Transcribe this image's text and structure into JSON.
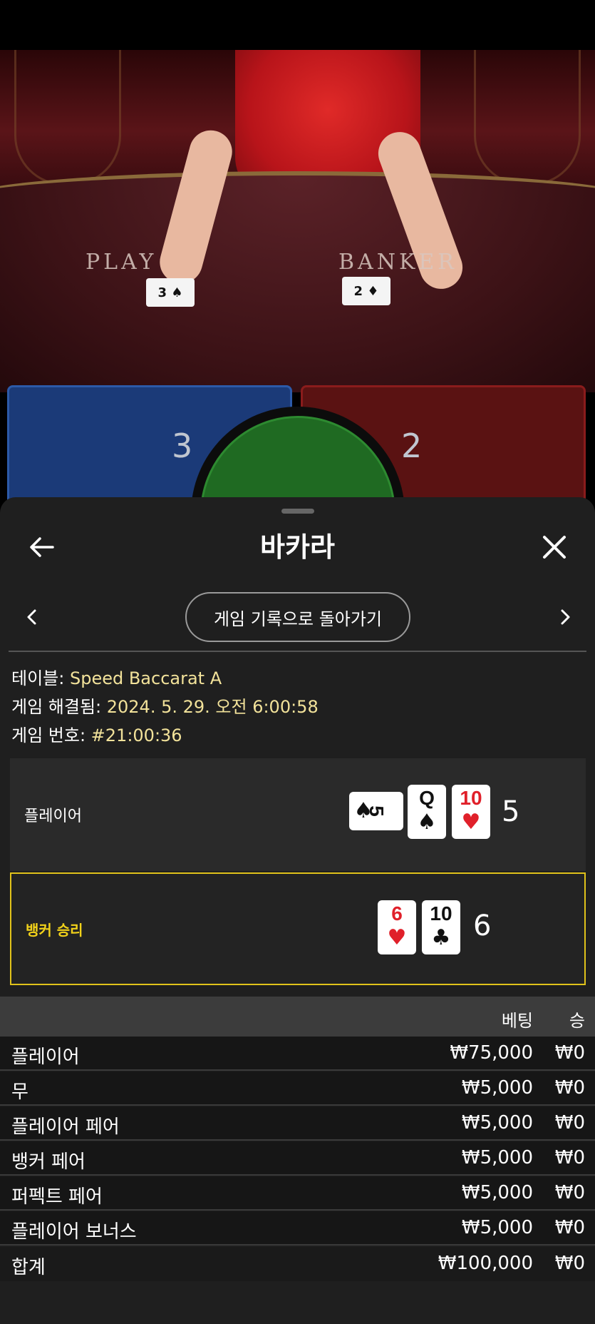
{
  "video": {
    "player_label": "PLAY",
    "banker_label": "BANKER",
    "player_card": "3 ♠",
    "banker_card": "2 ♦"
  },
  "scoreboard": {
    "player_score": "3",
    "banker_score": "2"
  },
  "panel": {
    "title": "바카라",
    "back_to_history": "게임 기록으로 돌아가기",
    "info": {
      "table_label": "테이블: ",
      "table_value": "Speed Baccarat A",
      "resolved_label": "게임 해결됨: ",
      "resolved_value": "2024. 5. 29. 오전 6:00:58",
      "game_no_label": "게임 번호: ",
      "game_no_value": "#21:00:36"
    },
    "player_hand": {
      "label": "플레이어",
      "cards": [
        {
          "rank": "5",
          "suit": "♠",
          "color": "black"
        },
        {
          "rank": "Q",
          "suit": "♠",
          "color": "black"
        },
        {
          "rank": "10",
          "suit": "♥",
          "color": "red"
        }
      ],
      "score": "5"
    },
    "banker_hand": {
      "label": "뱅커 승리",
      "cards": [
        {
          "rank": "6",
          "suit": "♥",
          "color": "red"
        },
        {
          "rank": "10",
          "suit": "♣",
          "color": "black"
        }
      ],
      "score": "6"
    },
    "bets_header": {
      "bet": "베팅",
      "win": "승"
    },
    "bets": [
      {
        "name": "플레이어",
        "amount": "₩75,000",
        "win": "₩0"
      },
      {
        "name": "무",
        "amount": "₩5,000",
        "win": "₩0"
      },
      {
        "name": "플레이어 페어",
        "amount": "₩5,000",
        "win": "₩0"
      },
      {
        "name": "뱅커 페어",
        "amount": "₩5,000",
        "win": "₩0"
      },
      {
        "name": "퍼펙트 페어",
        "amount": "₩5,000",
        "win": "₩0"
      },
      {
        "name": "플레이어 보너스",
        "amount": "₩5,000",
        "win": "₩0"
      },
      {
        "name": "합계",
        "amount": "₩100,000",
        "win": "₩0"
      }
    ]
  },
  "icons": {
    "back": "arrow-left-icon",
    "close": "close-icon",
    "prev": "chevron-left-icon",
    "next": "chevron-right-icon"
  }
}
